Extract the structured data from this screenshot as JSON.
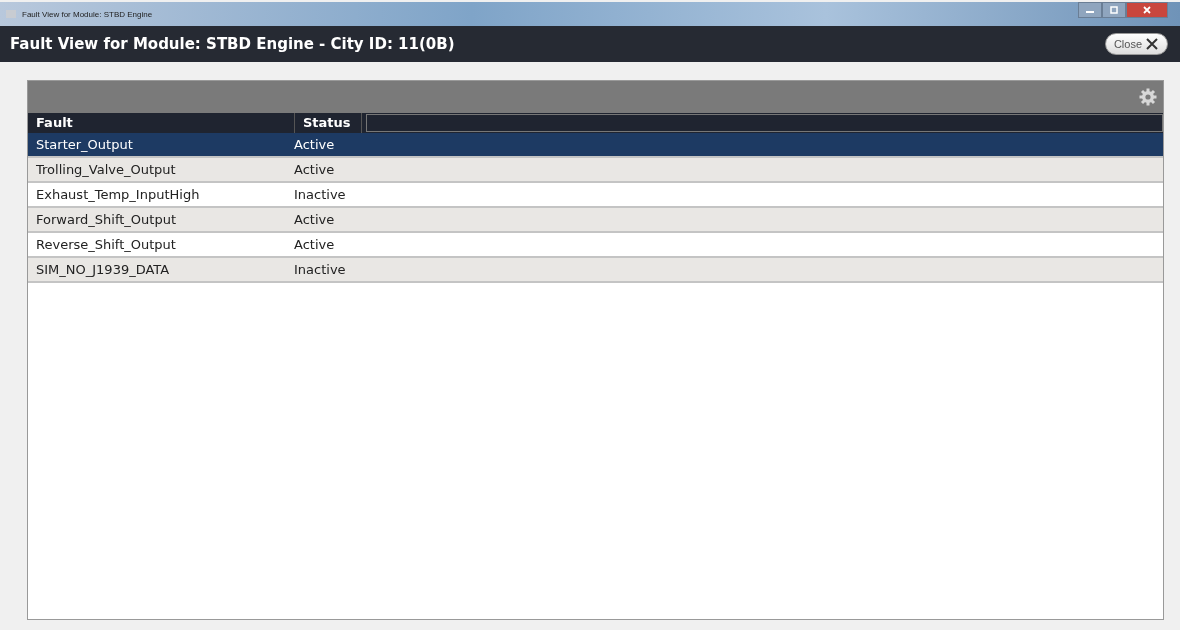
{
  "window": {
    "title": "Fault View for Module: STBD Engine"
  },
  "header": {
    "title": "Fault View for Module: STBD Engine - City ID: 11(0B)",
    "close_button": "Close"
  },
  "table": {
    "columns": [
      "Fault",
      "Status"
    ],
    "rows": [
      {
        "fault": "Starter_Output",
        "status": "Active",
        "selected": true
      },
      {
        "fault": "Trolling_Valve_Output",
        "status": "Active",
        "selected": false
      },
      {
        "fault": "Exhaust_Temp_InputHigh",
        "status": "Inactive",
        "selected": false
      },
      {
        "fault": "Forward_Shift_Output",
        "status": "Active",
        "selected": false
      },
      {
        "fault": "Reverse_Shift_Output",
        "status": "Active",
        "selected": false
      },
      {
        "fault": "SIM_NO_J1939_DATA",
        "status": "Inactive",
        "selected": false
      }
    ]
  }
}
